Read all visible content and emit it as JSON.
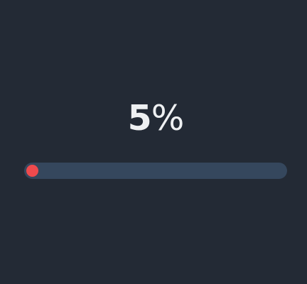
{
  "progress": {
    "number": "5",
    "suffix": "%",
    "value": 5,
    "track_color": "#35475d",
    "knob_color": "#ee4a4d"
  }
}
